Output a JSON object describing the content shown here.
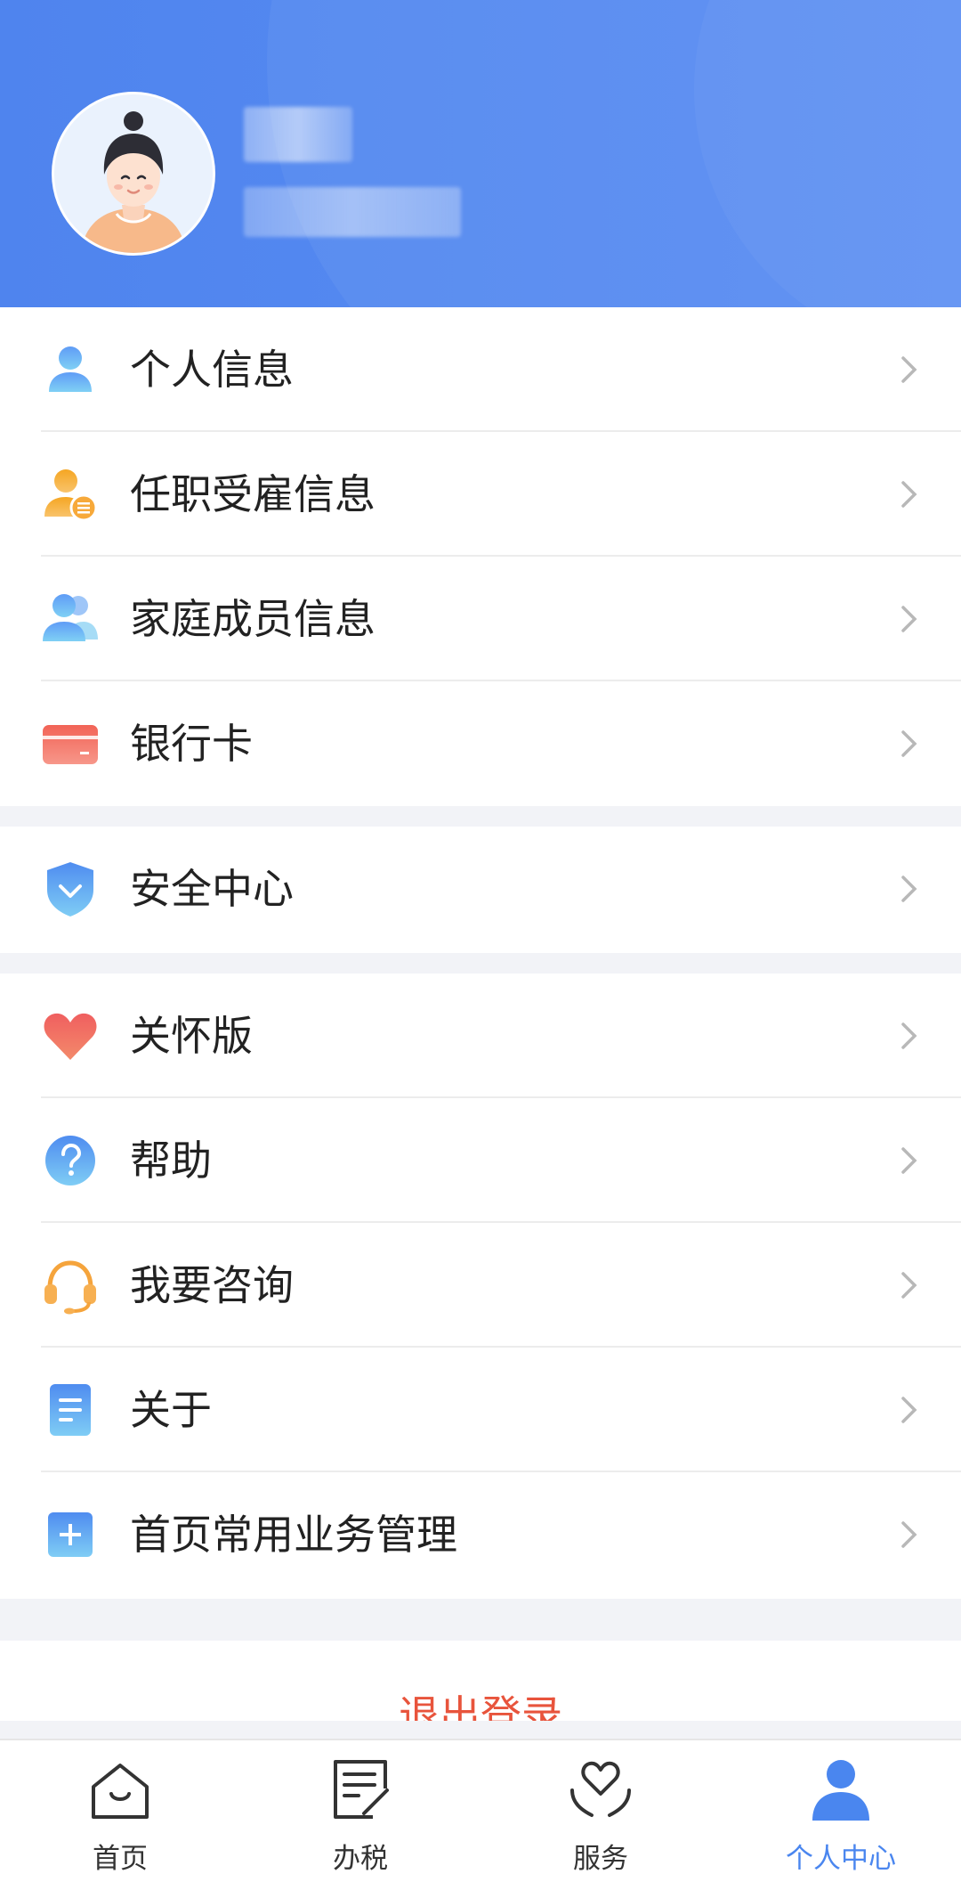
{
  "header": {
    "background": "#5089ef"
  },
  "menu_group_1": [
    {
      "label": "个人信息",
      "icon": "user-icon"
    },
    {
      "label": "任职受雇信息",
      "icon": "employment-icon"
    },
    {
      "label": "家庭成员信息",
      "icon": "family-icon"
    },
    {
      "label": "银行卡",
      "icon": "bank-card-icon"
    }
  ],
  "menu_group_2": [
    {
      "label": "安全中心",
      "icon": "shield-icon"
    }
  ],
  "menu_group_3": [
    {
      "label": "关怀版",
      "icon": "heart-icon"
    },
    {
      "label": "帮助",
      "icon": "help-icon"
    },
    {
      "label": "我要咨询",
      "icon": "headset-icon"
    },
    {
      "label": "关于",
      "icon": "document-icon"
    },
    {
      "label": "首页常用业务管理",
      "icon": "plus-square-icon"
    }
  ],
  "logout": {
    "label": "退出登录",
    "color": "#e8543c"
  },
  "tabbar": {
    "tabs": [
      {
        "label": "首页",
        "icon": "home-icon"
      },
      {
        "label": "办税",
        "icon": "tax-form-icon"
      },
      {
        "label": "服务",
        "icon": "service-heart-hands-icon"
      },
      {
        "label": "个人中心",
        "icon": "person-icon",
        "active": true
      }
    ],
    "active_color": "#4a86ef"
  }
}
